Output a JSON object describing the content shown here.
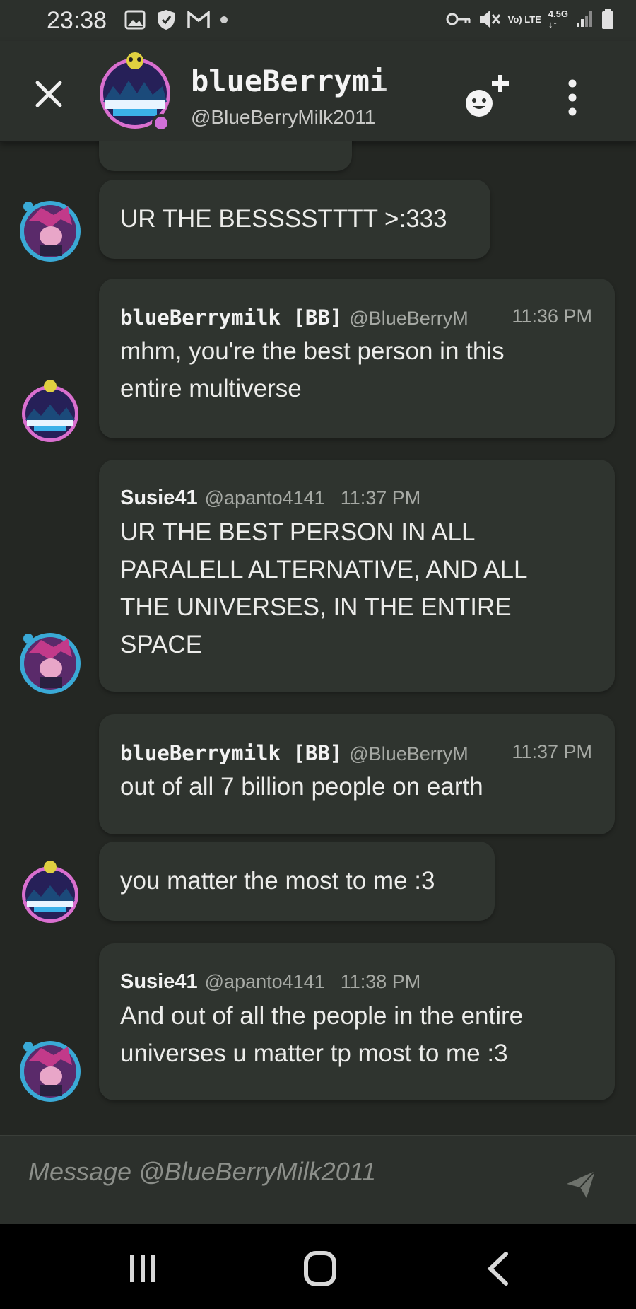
{
  "status_bar": {
    "time": "23:38",
    "network": "4.5G",
    "volte": "Vo) LTE"
  },
  "header": {
    "name": "blueBerrymi",
    "handle": "@BlueBerryMilk2011"
  },
  "messages": [
    {
      "type": "plain",
      "text": "UR THE BESSSSTTTT >:333",
      "avatar": "susie"
    },
    {
      "type": "full",
      "author": "blueBerrymilk [BB]",
      "handle": "@BlueBerryM",
      "time": "11:36 PM",
      "lines": [
        "mhm, you're the best person in this",
        "entire multiverse"
      ],
      "avatar": "blueberry"
    },
    {
      "type": "full",
      "author": "Susie41",
      "handle": "@apanto4141",
      "time": "11:37 PM",
      "lines": [
        "UR THE BEST PERSON IN ALL",
        "PARALELL ALTERNATIVE, AND ALL",
        "THE UNIVERSES, IN THE ENTIRE",
        "SPACE"
      ],
      "avatar": "susie"
    },
    {
      "type": "full",
      "author": "blueBerrymilk [BB]",
      "handle": "@BlueBerryM",
      "time": "11:37 PM",
      "lines": [
        "out of all 7 billion people on earth"
      ],
      "avatar": "none"
    },
    {
      "type": "plain",
      "text": "you matter the most to me :3",
      "avatar": "blueberry"
    },
    {
      "type": "full",
      "author": "Susie41",
      "handle": "@apanto4141",
      "time": "11:38 PM",
      "lines": [
        "And out of all the people in the entire",
        "universes u matter tp most to me :3"
      ],
      "avatar": "susie"
    }
  ],
  "composer": {
    "placeholder": "Message @BlueBerryMilk2011"
  },
  "colors": {
    "background": "#242723",
    "bubble": "#2f342f",
    "header": "#2c302c",
    "status_online": "#d070d8"
  }
}
